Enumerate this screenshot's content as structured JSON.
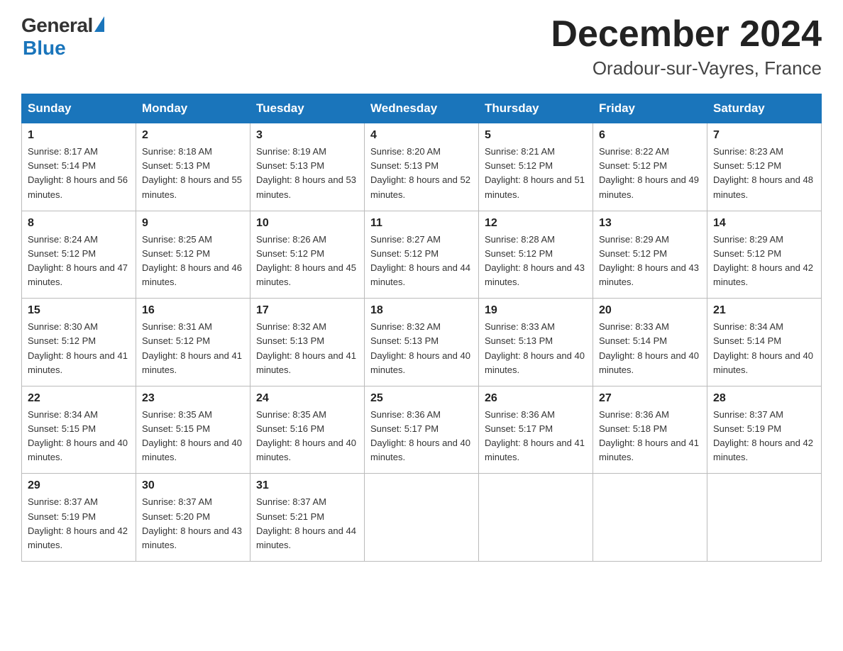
{
  "header": {
    "logo_general": "General",
    "logo_blue": "Blue",
    "month_title": "December 2024",
    "location": "Oradour-sur-Vayres, France"
  },
  "days_of_week": [
    "Sunday",
    "Monday",
    "Tuesday",
    "Wednesday",
    "Thursday",
    "Friday",
    "Saturday"
  ],
  "weeks": [
    [
      {
        "day": "1",
        "sunrise": "8:17 AM",
        "sunset": "5:14 PM",
        "daylight": "8 hours and 56 minutes."
      },
      {
        "day": "2",
        "sunrise": "8:18 AM",
        "sunset": "5:13 PM",
        "daylight": "8 hours and 55 minutes."
      },
      {
        "day": "3",
        "sunrise": "8:19 AM",
        "sunset": "5:13 PM",
        "daylight": "8 hours and 53 minutes."
      },
      {
        "day": "4",
        "sunrise": "8:20 AM",
        "sunset": "5:13 PM",
        "daylight": "8 hours and 52 minutes."
      },
      {
        "day": "5",
        "sunrise": "8:21 AM",
        "sunset": "5:12 PM",
        "daylight": "8 hours and 51 minutes."
      },
      {
        "day": "6",
        "sunrise": "8:22 AM",
        "sunset": "5:12 PM",
        "daylight": "8 hours and 49 minutes."
      },
      {
        "day": "7",
        "sunrise": "8:23 AM",
        "sunset": "5:12 PM",
        "daylight": "8 hours and 48 minutes."
      }
    ],
    [
      {
        "day": "8",
        "sunrise": "8:24 AM",
        "sunset": "5:12 PM",
        "daylight": "8 hours and 47 minutes."
      },
      {
        "day": "9",
        "sunrise": "8:25 AM",
        "sunset": "5:12 PM",
        "daylight": "8 hours and 46 minutes."
      },
      {
        "day": "10",
        "sunrise": "8:26 AM",
        "sunset": "5:12 PM",
        "daylight": "8 hours and 45 minutes."
      },
      {
        "day": "11",
        "sunrise": "8:27 AM",
        "sunset": "5:12 PM",
        "daylight": "8 hours and 44 minutes."
      },
      {
        "day": "12",
        "sunrise": "8:28 AM",
        "sunset": "5:12 PM",
        "daylight": "8 hours and 43 minutes."
      },
      {
        "day": "13",
        "sunrise": "8:29 AM",
        "sunset": "5:12 PM",
        "daylight": "8 hours and 43 minutes."
      },
      {
        "day": "14",
        "sunrise": "8:29 AM",
        "sunset": "5:12 PM",
        "daylight": "8 hours and 42 minutes."
      }
    ],
    [
      {
        "day": "15",
        "sunrise": "8:30 AM",
        "sunset": "5:12 PM",
        "daylight": "8 hours and 41 minutes."
      },
      {
        "day": "16",
        "sunrise": "8:31 AM",
        "sunset": "5:12 PM",
        "daylight": "8 hours and 41 minutes."
      },
      {
        "day": "17",
        "sunrise": "8:32 AM",
        "sunset": "5:13 PM",
        "daylight": "8 hours and 41 minutes."
      },
      {
        "day": "18",
        "sunrise": "8:32 AM",
        "sunset": "5:13 PM",
        "daylight": "8 hours and 40 minutes."
      },
      {
        "day": "19",
        "sunrise": "8:33 AM",
        "sunset": "5:13 PM",
        "daylight": "8 hours and 40 minutes."
      },
      {
        "day": "20",
        "sunrise": "8:33 AM",
        "sunset": "5:14 PM",
        "daylight": "8 hours and 40 minutes."
      },
      {
        "day": "21",
        "sunrise": "8:34 AM",
        "sunset": "5:14 PM",
        "daylight": "8 hours and 40 minutes."
      }
    ],
    [
      {
        "day": "22",
        "sunrise": "8:34 AM",
        "sunset": "5:15 PM",
        "daylight": "8 hours and 40 minutes."
      },
      {
        "day": "23",
        "sunrise": "8:35 AM",
        "sunset": "5:15 PM",
        "daylight": "8 hours and 40 minutes."
      },
      {
        "day": "24",
        "sunrise": "8:35 AM",
        "sunset": "5:16 PM",
        "daylight": "8 hours and 40 minutes."
      },
      {
        "day": "25",
        "sunrise": "8:36 AM",
        "sunset": "5:17 PM",
        "daylight": "8 hours and 40 minutes."
      },
      {
        "day": "26",
        "sunrise": "8:36 AM",
        "sunset": "5:17 PM",
        "daylight": "8 hours and 41 minutes."
      },
      {
        "day": "27",
        "sunrise": "8:36 AM",
        "sunset": "5:18 PM",
        "daylight": "8 hours and 41 minutes."
      },
      {
        "day": "28",
        "sunrise": "8:37 AM",
        "sunset": "5:19 PM",
        "daylight": "8 hours and 42 minutes."
      }
    ],
    [
      {
        "day": "29",
        "sunrise": "8:37 AM",
        "sunset": "5:19 PM",
        "daylight": "8 hours and 42 minutes."
      },
      {
        "day": "30",
        "sunrise": "8:37 AM",
        "sunset": "5:20 PM",
        "daylight": "8 hours and 43 minutes."
      },
      {
        "day": "31",
        "sunrise": "8:37 AM",
        "sunset": "5:21 PM",
        "daylight": "8 hours and 44 minutes."
      },
      null,
      null,
      null,
      null
    ]
  ]
}
